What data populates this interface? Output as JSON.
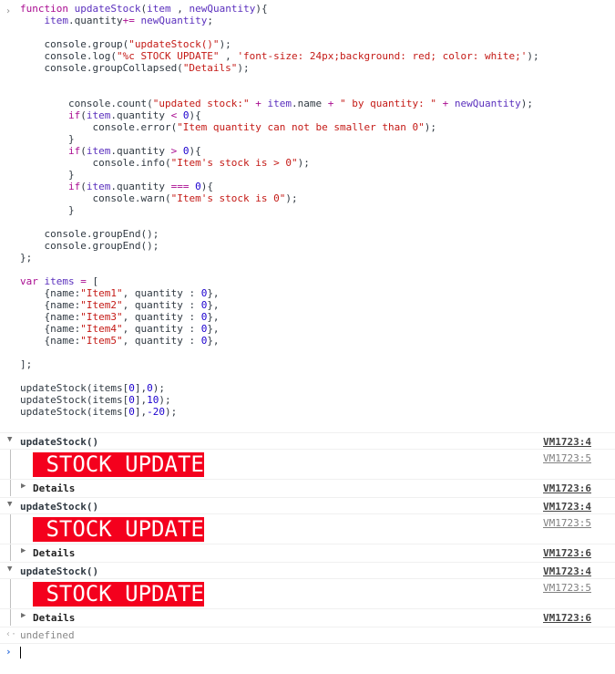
{
  "code": {
    "lines": [
      [
        [
          "kw",
          "function "
        ],
        [
          "vr2",
          "updateStock"
        ],
        [
          "pr",
          "("
        ],
        [
          "vr2",
          "item"
        ],
        [
          "pr",
          " , "
        ],
        [
          "vr2",
          "newQuantity"
        ],
        [
          "pr",
          "){"
        ]
      ],
      [
        [
          "pr",
          "    "
        ],
        [
          "vr2",
          "item"
        ],
        [
          "pr",
          ".quantity"
        ],
        [
          "op",
          "+="
        ],
        [
          "pr",
          " "
        ],
        [
          "vr2",
          "newQuantity"
        ],
        [
          "pr",
          ";"
        ]
      ],
      [],
      [
        [
          "pr",
          "    console.group("
        ],
        [
          "st",
          "\"updateStock()\""
        ],
        [
          "pr",
          ");"
        ]
      ],
      [
        [
          "pr",
          "    console.log("
        ],
        [
          "st",
          "\"%c STOCK UPDATE\""
        ],
        [
          "pr",
          " , "
        ],
        [
          "st",
          "'font-size: 24px;background: red; color: white;'"
        ],
        [
          "pr",
          ");"
        ]
      ],
      [
        [
          "pr",
          "    console.groupCollapsed("
        ],
        [
          "st",
          "\"Details\""
        ],
        [
          "pr",
          ");"
        ]
      ],
      [],
      [],
      [
        [
          "pr",
          "        console.count("
        ],
        [
          "st",
          "\"updated stock:\""
        ],
        [
          "pr",
          " "
        ],
        [
          "op",
          "+"
        ],
        [
          "pr",
          " "
        ],
        [
          "vr2",
          "item"
        ],
        [
          "pr",
          ".name "
        ],
        [
          "op",
          "+"
        ],
        [
          "pr",
          " "
        ],
        [
          "st",
          "\" by quantity: \""
        ],
        [
          "pr",
          " "
        ],
        [
          "op",
          "+"
        ],
        [
          "pr",
          " "
        ],
        [
          "vr2",
          "newQuantity"
        ],
        [
          "pr",
          ");"
        ]
      ],
      [
        [
          "pr",
          "        "
        ],
        [
          "kw",
          "if"
        ],
        [
          "pr",
          "("
        ],
        [
          "vr2",
          "item"
        ],
        [
          "pr",
          ".quantity "
        ],
        [
          "op",
          "<"
        ],
        [
          "pr",
          " "
        ],
        [
          "nm",
          "0"
        ],
        [
          "pr",
          "){"
        ]
      ],
      [
        [
          "pr",
          "            console.error("
        ],
        [
          "st",
          "\"Item quantity can not be smaller than 0\""
        ],
        [
          "pr",
          ");"
        ]
      ],
      [
        [
          "pr",
          "        }"
        ]
      ],
      [
        [
          "pr",
          "        "
        ],
        [
          "kw",
          "if"
        ],
        [
          "pr",
          "("
        ],
        [
          "vr2",
          "item"
        ],
        [
          "pr",
          ".quantity "
        ],
        [
          "op",
          ">"
        ],
        [
          "pr",
          " "
        ],
        [
          "nm",
          "0"
        ],
        [
          "pr",
          "){"
        ]
      ],
      [
        [
          "pr",
          "            console.info("
        ],
        [
          "st",
          "\"Item's stock is > 0\""
        ],
        [
          "pr",
          ");"
        ]
      ],
      [
        [
          "pr",
          "        }"
        ]
      ],
      [
        [
          "pr",
          "        "
        ],
        [
          "kw",
          "if"
        ],
        [
          "pr",
          "("
        ],
        [
          "vr2",
          "item"
        ],
        [
          "pr",
          ".quantity "
        ],
        [
          "op",
          "==="
        ],
        [
          "pr",
          " "
        ],
        [
          "nm",
          "0"
        ],
        [
          "pr",
          "){"
        ]
      ],
      [
        [
          "pr",
          "            console.warn("
        ],
        [
          "st",
          "\"Item's stock is 0\""
        ],
        [
          "pr",
          ");"
        ]
      ],
      [
        [
          "pr",
          "        }"
        ]
      ],
      [],
      [
        [
          "pr",
          "    console.groupEnd();"
        ]
      ],
      [
        [
          "pr",
          "    console.groupEnd();"
        ]
      ],
      [
        [
          "pr",
          "};"
        ]
      ],
      [],
      [
        [
          "kw",
          "var "
        ],
        [
          "vr2",
          "items"
        ],
        [
          "pr",
          " "
        ],
        [
          "op",
          "="
        ],
        [
          "pr",
          " ["
        ]
      ],
      [
        [
          "pr",
          "    {name:"
        ],
        [
          "st",
          "\"Item1\""
        ],
        [
          "pr",
          ", quantity : "
        ],
        [
          "nm",
          "0"
        ],
        [
          "pr",
          "},"
        ]
      ],
      [
        [
          "pr",
          "    {name:"
        ],
        [
          "st",
          "\"Item2\""
        ],
        [
          "pr",
          ", quantity : "
        ],
        [
          "nm",
          "0"
        ],
        [
          "pr",
          "},"
        ]
      ],
      [
        [
          "pr",
          "    {name:"
        ],
        [
          "st",
          "\"Item3\""
        ],
        [
          "pr",
          ", quantity : "
        ],
        [
          "nm",
          "0"
        ],
        [
          "pr",
          "},"
        ]
      ],
      [
        [
          "pr",
          "    {name:"
        ],
        [
          "st",
          "\"Item4\""
        ],
        [
          "pr",
          ", quantity : "
        ],
        [
          "nm",
          "0"
        ],
        [
          "pr",
          "},"
        ]
      ],
      [
        [
          "pr",
          "    {name:"
        ],
        [
          "st",
          "\"Item5\""
        ],
        [
          "pr",
          ", quantity : "
        ],
        [
          "nm",
          "0"
        ],
        [
          "pr",
          "},"
        ]
      ],
      [],
      [
        [
          "pr",
          "];"
        ]
      ],
      [],
      [
        [
          "pr",
          "updateStock(items["
        ],
        [
          "nm",
          "0"
        ],
        [
          "pr",
          "],"
        ],
        [
          "nm",
          "0"
        ],
        [
          "pr",
          ");"
        ]
      ],
      [
        [
          "pr",
          "updateStock(items["
        ],
        [
          "nm",
          "0"
        ],
        [
          "pr",
          "],"
        ],
        [
          "nm",
          "10"
        ],
        [
          "pr",
          ");"
        ]
      ],
      [
        [
          "pr",
          "updateStock(items["
        ],
        [
          "nm",
          "0"
        ],
        [
          "pr",
          "],"
        ],
        [
          "nm",
          "-20"
        ],
        [
          "pr",
          ");"
        ]
      ]
    ]
  },
  "groups": [
    {
      "title": "updateStock()",
      "src_group": "VM1723:4",
      "stock_text": " STOCK UPDATE",
      "src_log": "VM1723:5",
      "details_label": "Details",
      "src_details": "VM1723:6"
    },
    {
      "title": "updateStock()",
      "src_group": "VM1723:4",
      "stock_text": " STOCK UPDATE",
      "src_log": "VM1723:5",
      "details_label": "Details",
      "src_details": "VM1723:6"
    },
    {
      "title": "updateStock()",
      "src_group": "VM1723:4",
      "stock_text": " STOCK UPDATE",
      "src_log": "VM1723:5",
      "details_label": "Details",
      "src_details": "VM1723:6"
    }
  ],
  "result": {
    "value": "undefined"
  },
  "icons": {
    "prompt": "›",
    "expanded": "▼",
    "collapsed": "▶",
    "return": "‹·",
    "input": "›"
  },
  "colors": {
    "stock_bg": "#f4001d",
    "stock_fg": "#ffffff"
  }
}
